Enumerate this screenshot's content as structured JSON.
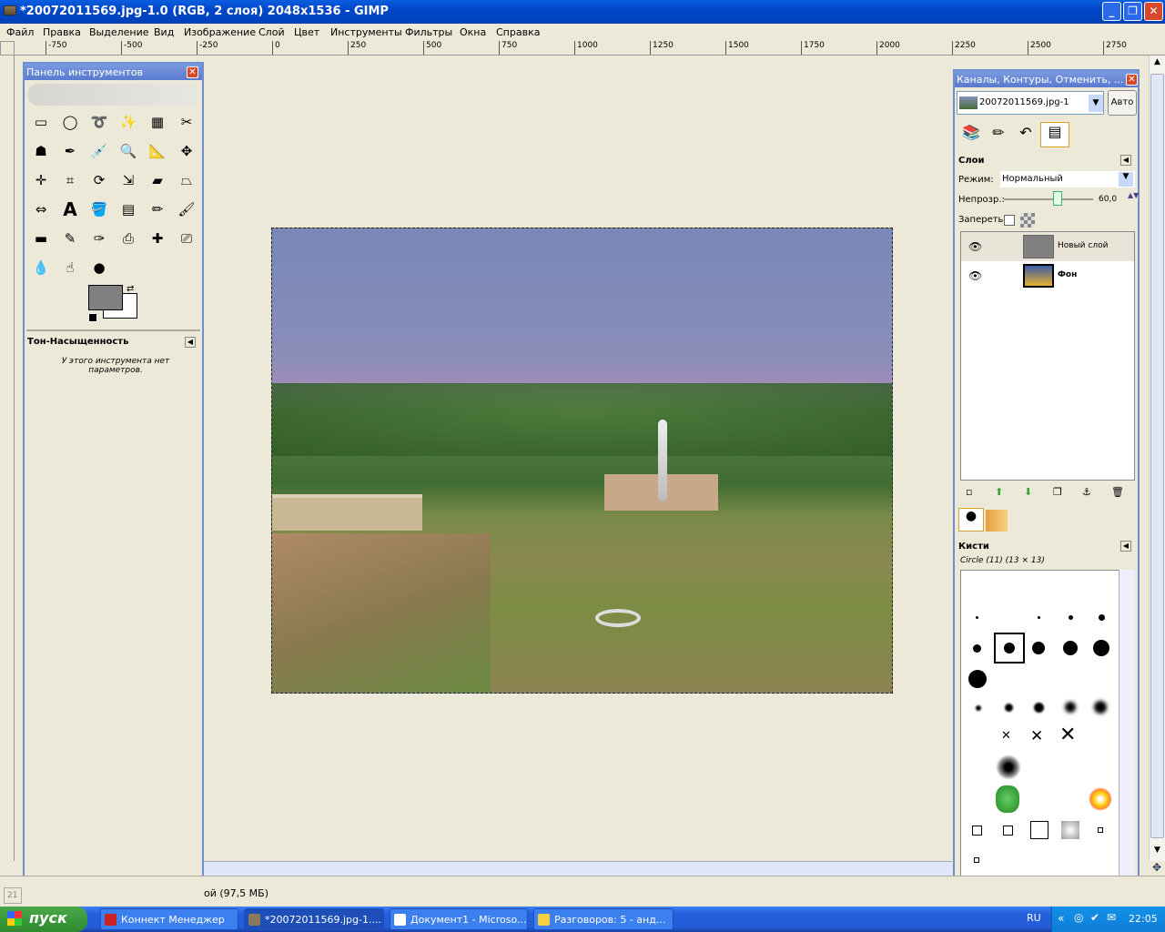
{
  "window": {
    "title": "*20072011569.jpg-1.0 (RGB, 2 слоя) 2048x1536 - GIMP"
  },
  "menu": [
    "Файл",
    "Правка",
    "Выделение",
    "Вид",
    "Изображение",
    "Слой",
    "Цвет",
    "Инструменты",
    "Фильтры",
    "Окна",
    "Справка"
  ],
  "ruler": {
    "ticks": [
      "-750",
      "-500",
      "-250",
      "0",
      "250",
      "500",
      "750",
      "1000",
      "1250",
      "1500",
      "1750",
      "2000",
      "2250",
      "2500",
      "2750"
    ]
  },
  "toolbox": {
    "title": "Панель инструментов",
    "options_title": "Тон-Насыщенность",
    "options_text": "У этого инструмента нет параметров."
  },
  "dock": {
    "title": "Каналы, Контуры, Отменить, ...",
    "image_select": "20072011569.jpg-1",
    "auto_button": "Авто",
    "layers": {
      "title": "Слои",
      "mode_label": "Режим:",
      "mode_value": "Нормальный",
      "opacity_label": "Непрозр.:",
      "opacity_value": "60,0",
      "lock_label": "Запереть:",
      "items": [
        {
          "name": "Новый слой"
        },
        {
          "name": "Фон"
        }
      ]
    },
    "brushes": {
      "title": "Кисти",
      "current": "Circle (11) (13 × 13)"
    }
  },
  "status": {
    "left": "21",
    "text": "ой (97,5 МБ)"
  },
  "taskbar": {
    "start": "пуск",
    "tasks": [
      "Коннект Менеджер",
      "*20072011569.jpg-1....",
      "Документ1 - Microso...",
      "Разговоров: 5 - анд..."
    ],
    "lang": "RU",
    "clock": "22:05"
  },
  "colors": {
    "title": "#0046c8",
    "accent": "#6d8fd0",
    "fg": "#808080",
    "bg": "#ffffff"
  }
}
